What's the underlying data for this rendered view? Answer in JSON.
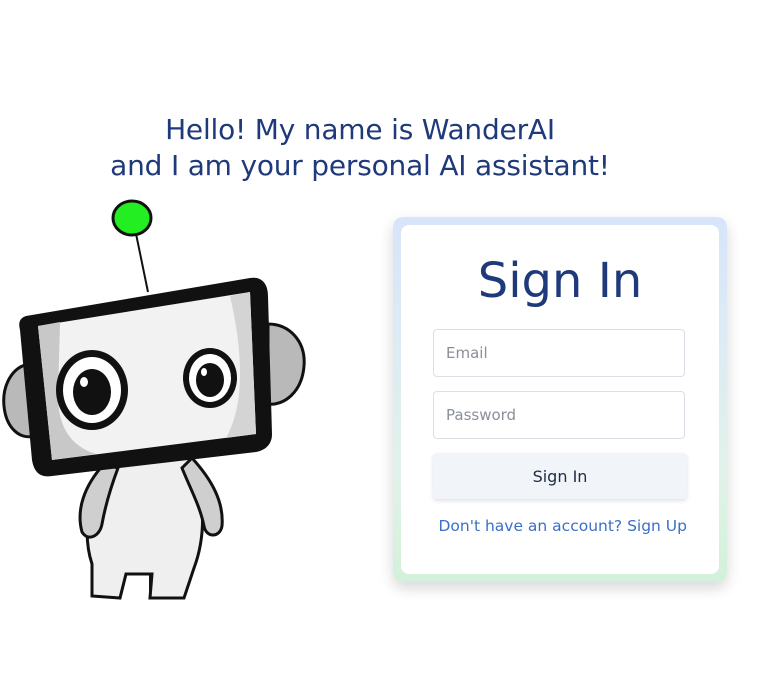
{
  "greeting": {
    "line1": "Hello! My name is WanderAI",
    "line2": "and I am your personal AI assistant!"
  },
  "mascot": {
    "icon": "robot-mascot-icon",
    "antenna_color": "#22ee22"
  },
  "signin": {
    "title": "Sign In",
    "email_placeholder": "Email",
    "email_value": "",
    "password_placeholder": "Password",
    "password_value": "",
    "submit_label": "Sign In",
    "signup_prompt": "Don't have an account? Sign Up"
  },
  "colors": {
    "heading": "#1f3a7a",
    "link": "#3b6fc7",
    "button_bg": "#f1f4f9"
  }
}
